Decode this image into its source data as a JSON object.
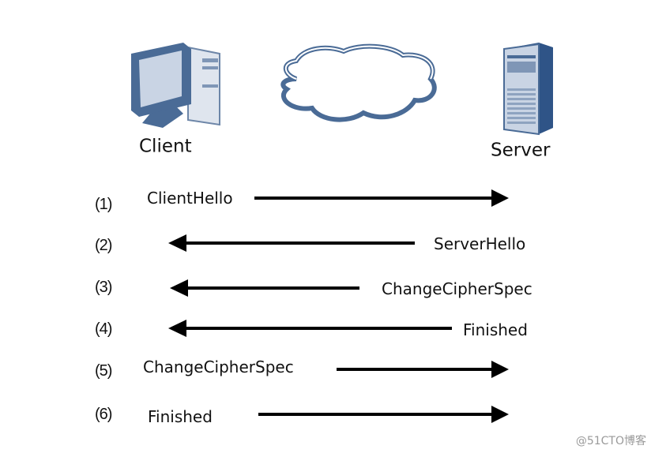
{
  "nodes": {
    "client": {
      "label": "Client",
      "icon": "desktop-computer-icon"
    },
    "network": {
      "icon": "cloud-icon"
    },
    "server": {
      "label": "Server",
      "icon": "server-tower-icon"
    }
  },
  "messages": [
    {
      "step": "(1)",
      "label": "ClientHello",
      "direction": "client-to-server"
    },
    {
      "step": "(2)",
      "label": "ServerHello",
      "direction": "server-to-client"
    },
    {
      "step": "(3)",
      "label": "ChangeCipherSpec",
      "direction": "server-to-client"
    },
    {
      "step": "(4)",
      "label": "Finished",
      "direction": "server-to-client"
    },
    {
      "step": "(5)",
      "label": "ChangeCipherSpec",
      "direction": "client-to-server"
    },
    {
      "step": "(6)",
      "label": "Finished",
      "direction": "client-to-server"
    }
  ],
  "watermark": "@51CTO博客",
  "colors": {
    "icon_blue": "#4a6b96",
    "icon_light": "#c9d4e4",
    "arrow": "#000000"
  }
}
